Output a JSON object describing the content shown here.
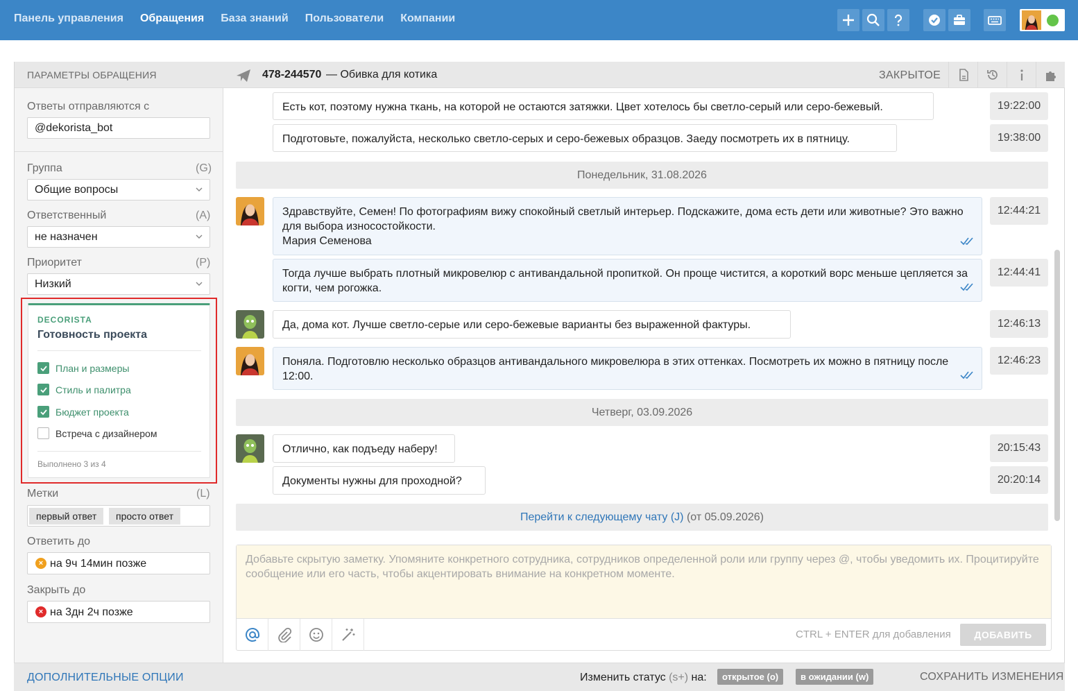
{
  "nav": {
    "items": [
      "Панель управления",
      "Обращения",
      "База знаний",
      "Пользователи",
      "Компании"
    ]
  },
  "toolbar": {
    "icons": [
      "plus-icon",
      "search-icon",
      "help-icon",
      "check-badge-icon",
      "briefcase-icon",
      "keyboard-icon"
    ],
    "status_color": "#64c449"
  },
  "left": {
    "header": "ПАРАМЕТРЫ ОБРАЩЕНИЯ",
    "reply_from_label": "Ответы отправляются с",
    "reply_from_value": "@dekorista_bot",
    "group_label": "Группа",
    "group_key": "(G)",
    "group_value": "Общие вопросы",
    "assignee_label": "Ответственный",
    "assignee_key": "(A)",
    "assignee_value": "не назначен",
    "priority_label": "Приоритет",
    "priority_key": "(P)",
    "priority_value": "Низкий",
    "tags_label": "Метки",
    "tags_key": "(L)",
    "tags": [
      "первый ответ",
      "просто ответ"
    ],
    "reply_by_label": "Ответить до",
    "reply_by_value": "на 9ч 14мин позже",
    "close_by_label": "Закрыть до",
    "close_by_value": "на 3дн 2ч позже"
  },
  "widget": {
    "brand": "DECORISTA",
    "title": "Готовность проекта",
    "accent": "#4a9f7a",
    "items": [
      {
        "label": "План и размеры",
        "checked": true
      },
      {
        "label": "Стиль и палитра",
        "checked": true
      },
      {
        "label": "Бюджет проекта",
        "checked": true
      },
      {
        "label": "Встреча с дизайнером",
        "checked": false
      }
    ],
    "footer": "Выполнено 3 из 4"
  },
  "chat": {
    "number": "478-244570",
    "dash": "—",
    "subject": "Обивка для котика",
    "status": "ЗАКРЫТОЕ",
    "messages": [
      {
        "text": "Есть кот, поэтому нужна ткань, на которой не остаются затяжки. Цвет хотелось бы светло-серый или серо-бежевый.",
        "time": "19:22:00"
      },
      {
        "text": "Подготовьте, пожалуйста, несколько светло-серых и серо-бежевых образцов. Заеду посмотреть их в пятницу.",
        "time": "19:38:00"
      },
      {
        "text": "Здравствуйте, Семен! По фотографиям вижу спокойный светлый интерьер. Подскажите, дома есть дети или животные? Это важно для выбора износостойкости.\nМария Семенова",
        "time": "12:44:21"
      },
      {
        "text": "Тогда лучше выбрать плотный микровелюр с антивандальной пропиткой. Он проще чистится, а короткий ворс меньше цепляется за когти, чем рогожка.",
        "time": "12:44:41"
      },
      {
        "text": "Да, дома кот. Лучше светло-серые или серо-бежевые варианты без выраженной фактуры.",
        "time": "12:46:13"
      },
      {
        "text": "Поняла. Подготовлю несколько образцов антивандального микровелюра в этих оттенках. Посмотреть их можно в пятницу после 12:00.",
        "time": "12:46:23"
      },
      {
        "text": "Отлично, как подъеду наберу!",
        "time": "20:15:43"
      },
      {
        "text": "Документы нужны для проходной?",
        "time": "20:20:14"
      }
    ],
    "day1": "Понедельник, 31.08.2026",
    "day2": "Четверг, 03.09.2026",
    "next_link": "Перейти к следующему чату (J)",
    "next_date": " (от 05.09.2026)"
  },
  "composer": {
    "placeholder": "Добавьте скрытую заметку. Упомяните конкретного сотрудника, сотрудников определенной роли или группу через @, чтобы уведомить их. Процитируйте сообщение или его часть, чтобы акцентировать внимание на конкретном моменте.",
    "hint": "CTRL + ENTER для добавления",
    "add_button": "ДОБАВИТЬ"
  },
  "footer": {
    "more_options": "ДОПОЛНИТЕЛЬНЫЕ ОПЦИИ",
    "change_status_prefix": "Изменить статус ",
    "change_status_key": "(s+)",
    "change_status_suffix": " на:",
    "status_open": "открытое (o)",
    "status_pending": "в ожидании (w)",
    "save": "СОХРАНИТЬ ИЗМЕНЕНИЯ"
  }
}
